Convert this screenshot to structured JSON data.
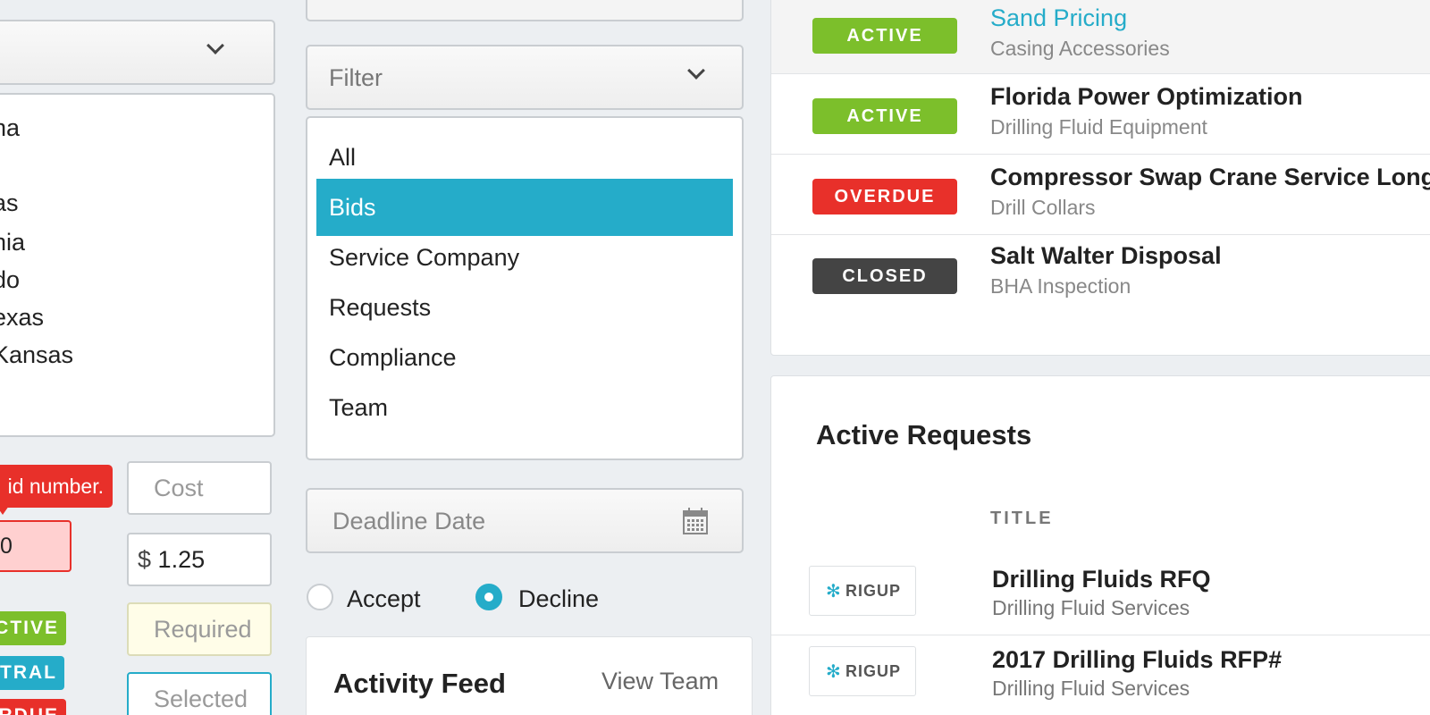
{
  "left": {
    "select_chevron": "chevron-down-icon",
    "states": [
      "na",
      "",
      "as",
      "nia",
      "do",
      "exas",
      "Kansas",
      "."
    ],
    "tooltip": "id number.",
    "error_value": "0",
    "badges": [
      {
        "label": "CTIVE",
        "color": "#7cbf2b"
      },
      {
        "label": "TRAL",
        "color": "#25acc9"
      },
      {
        "label": "RDUE",
        "color": "#e8302a"
      }
    ],
    "inputs": {
      "cost_placeholder": "Cost",
      "currency": "$",
      "price_value": "1.25",
      "required_placeholder": "Required",
      "selected_placeholder": "Selected"
    }
  },
  "middle": {
    "filter_placeholder": "Filter",
    "filter_options": [
      "All",
      "Bids",
      "Service Company",
      "Requests",
      "Compliance",
      "Team"
    ],
    "selected_index": 1,
    "deadline_placeholder": "Deadline Date",
    "radios": [
      {
        "label": "Accept",
        "checked": false
      },
      {
        "label": "Decline",
        "checked": true
      }
    ],
    "feed": {
      "title": "Activity Feed",
      "link": "View Team"
    }
  },
  "projects": [
    {
      "status": "ACTIVE",
      "color": "#7cbf2b",
      "title": "Sand Pricing",
      "subtitle": "Casing Accessories",
      "highlight": true
    },
    {
      "status": "ACTIVE",
      "color": "#7cbf2b",
      "title": "Florida Power Optimization",
      "subtitle": "Drilling Fluid Equipment"
    },
    {
      "status": "OVERDUE",
      "color": "#e8302a",
      "title": "Compressor Swap Crane Service Long...",
      "subtitle": "Drill Collars"
    },
    {
      "status": "CLOSED",
      "color": "#444444",
      "title": "Salt Walter Disposal",
      "subtitle": "BHA Inspection"
    }
  ],
  "requests": {
    "title": "Active Requests",
    "column_title": "TITLE",
    "logo_text": "RIGUP",
    "items": [
      {
        "title": "Drilling Fluids RFQ",
        "subtitle": "Drilling Fluid Services"
      },
      {
        "title": "2017 Drilling Fluids RFP#",
        "subtitle": "Drilling Fluid Services"
      }
    ]
  },
  "colors": {
    "accent": "#25acc9",
    "link": "#25acc9",
    "error": "#e8302a",
    "success": "#7cbf2b"
  }
}
